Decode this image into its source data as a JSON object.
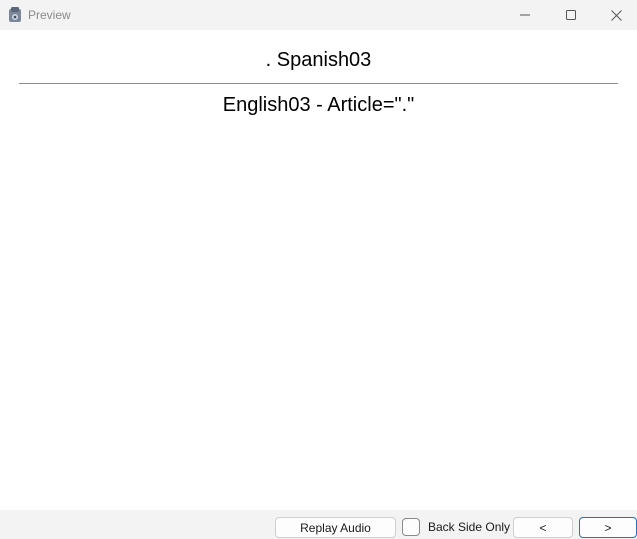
{
  "window": {
    "title": "Preview",
    "controls": [
      "minimize-icon",
      "maximize-icon",
      "close-icon"
    ]
  },
  "card": {
    "front": ". Spanish03",
    "back": "English03 - Article=\".\""
  },
  "bottom_bar": {
    "replay_label": "Replay Audio",
    "back_side_only_label": "Back Side Only",
    "back_side_only_checked": false,
    "prev_label": "<",
    "next_label": ">"
  },
  "colors": {
    "titlebar_bg": "#f3f3f3",
    "content_bg": "#ffffff",
    "divider": "#8c8c8c",
    "focus_border": "#2c6fb5"
  }
}
